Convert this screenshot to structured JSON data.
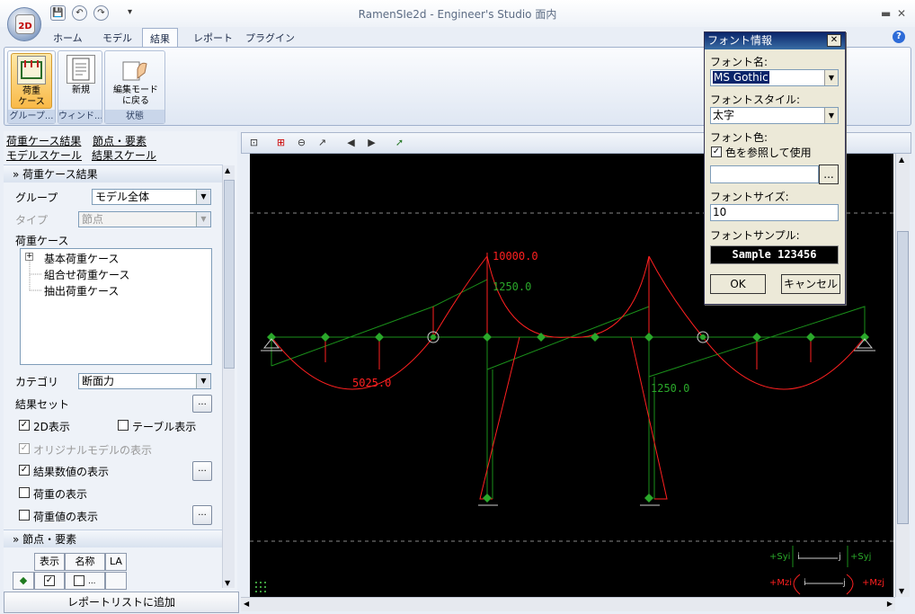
{
  "window": {
    "title": "RamenSIe2d - Engineer's Studio 面内",
    "app_icon_text": "2D"
  },
  "quick_access": {
    "save": "💾",
    "undo": "↶",
    "redo": "↷",
    "customize": "▾"
  },
  "ribbon_tabs": [
    "ホーム",
    "モデル",
    "結果",
    "レポート",
    "プラグイン"
  ],
  "ribbon": {
    "groups": [
      {
        "label": "グループ...",
        "buttons": [
          "荷重\nケース"
        ]
      },
      {
        "label": "ウィンド...",
        "buttons": [
          "新規"
        ]
      },
      {
        "label": "状態",
        "buttons": [
          "編集モード\nに戻る"
        ]
      }
    ]
  },
  "left_panel": {
    "links": [
      "荷重ケース結果",
      "節点・要素",
      "モデルスケール",
      "結果スケール"
    ],
    "section1": "荷重ケース結果",
    "group_label": "グループ",
    "group_value": "モデル全体",
    "type_label": "タイプ",
    "type_value": "節点",
    "loadcase_label": "荷重ケース",
    "tree": [
      "基本荷重ケース",
      "組合せ荷重ケース",
      "抽出荷重ケース"
    ],
    "category_label": "カテゴリ",
    "category_value": "断面力",
    "resultset_label": "結果セット",
    "chk_2d": "2D表示",
    "chk_table": "テーブル表示",
    "chk_original": "オリジナルモデルの表示",
    "chk_values": "結果数値の表示",
    "chk_load": "荷重の表示",
    "chk_loadval": "荷重値の表示",
    "section2": "節点・要素",
    "grid_headers": [
      "表示",
      "名称",
      "LA"
    ],
    "add_report": "レポートリストに追加",
    "ellipsis": "..."
  },
  "canvas": {
    "labels": {
      "top_moment": "10000.0",
      "upper_shear": "1250.0",
      "span_moment": "5025.0",
      "lower_shear": "1250.0"
    },
    "legend": {
      "syi": "+Syi",
      "syj": "+Syj",
      "mzi": "+Mzi",
      "mzj": "+Mzj",
      "i": "i",
      "j": "j"
    }
  },
  "font_dialog": {
    "title": "フォント情報",
    "font_name_label": "フォント名:",
    "font_name_value": "MS Gothic",
    "font_style_label": "フォントスタイル:",
    "font_style_value": "太字",
    "font_color_label": "フォント色:",
    "ref_color_label": "色を参照して使用",
    "font_size_label": "フォントサイズ:",
    "font_size_value": "10",
    "sample_label": "フォントサンプル:",
    "sample_text": "Sample 123456",
    "ok": "OK",
    "cancel": "キャンセル",
    "ellipsis": "..."
  },
  "colors": {
    "moment": "#ff2020",
    "frame": "#00b000",
    "node": "#2f8f2f",
    "canvas_bg": "#000000"
  }
}
